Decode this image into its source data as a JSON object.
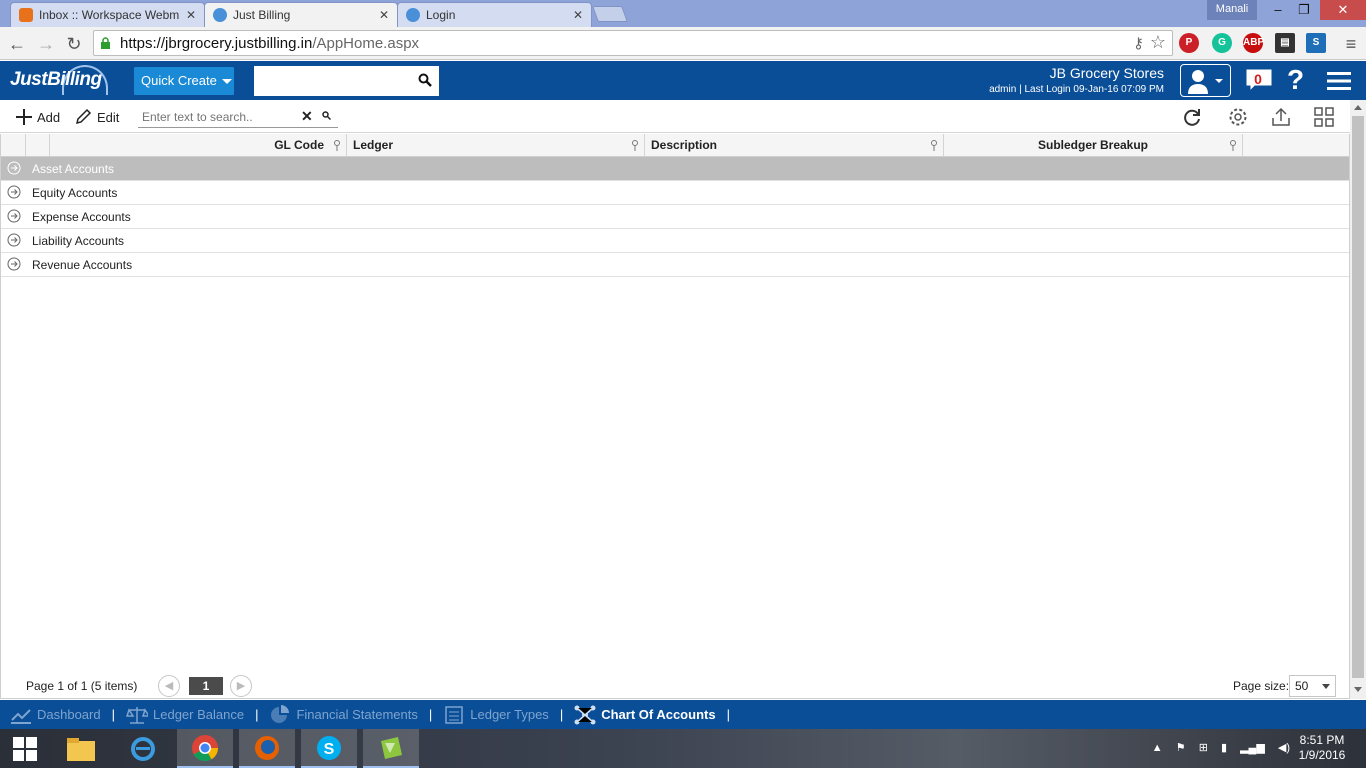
{
  "browser": {
    "tabs": [
      {
        "title": "Inbox :: Workspace Webm",
        "active": false
      },
      {
        "title": "Just Billing",
        "active": true
      },
      {
        "title": "Login",
        "active": false
      }
    ],
    "profile_name": "Manali",
    "url_main": "https://jbrgrocery.justbilling.in",
    "url_path": "/AppHome.aspx"
  },
  "app": {
    "logo": "JustBilling",
    "quick_create_label": "Quick Create",
    "store_name": "JB Grocery Stores",
    "login_info": "admin | Last Login 09-Jan-16 07:09 PM",
    "notification_count": "0"
  },
  "toolbar": {
    "add_label": "Add",
    "edit_label": "Edit",
    "search_placeholder": "Enter text to search.."
  },
  "grid": {
    "columns": [
      "GL Code",
      "Ledger",
      "Description",
      "Subledger Breakup"
    ],
    "groups": [
      "Asset Accounts",
      "Equity Accounts",
      "Expense Accounts",
      "Liability Accounts",
      "Revenue Accounts"
    ],
    "selected_group": "Asset Accounts"
  },
  "pager": {
    "info": "Page 1 of 1 (5 items)",
    "current_page": "1",
    "page_size_label": "Page size:",
    "page_size": "50"
  },
  "bottom_nav": [
    {
      "label": "Dashboard",
      "active": false
    },
    {
      "label": "Ledger Balance",
      "active": false
    },
    {
      "label": "Financial Statements",
      "active": false
    },
    {
      "label": "Ledger Types",
      "active": false
    },
    {
      "label": "Chart Of Accounts",
      "active": true
    }
  ],
  "taskbar": {
    "time": "8:51 PM",
    "date": "1/9/2016"
  },
  "colors": {
    "brand_blue": "#0a4e97",
    "quick_create": "#1a8ad6",
    "selected_row": "#bdbdbd"
  }
}
